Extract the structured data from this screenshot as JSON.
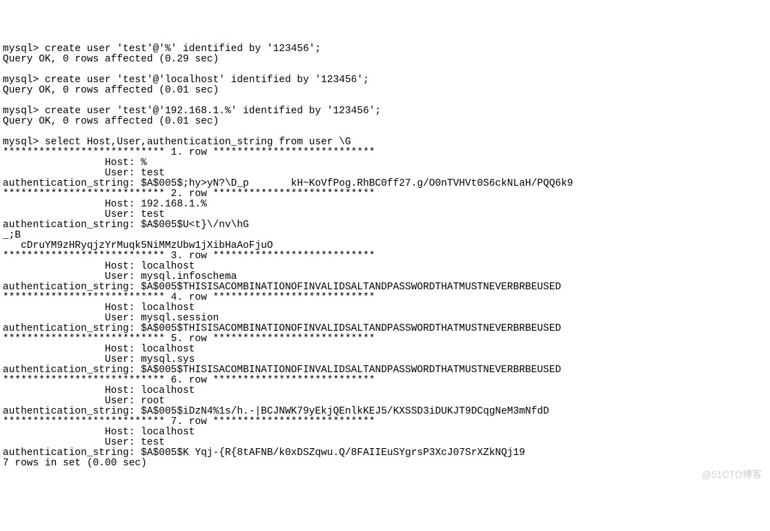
{
  "lines": [
    "mysql> create user 'test'@'%' identified by '123456';",
    "Query OK, 0 rows affected (0.29 sec)",
    "",
    "mysql> create user 'test'@'localhost' identified by '123456';",
    "Query OK, 0 rows affected (0.01 sec)",
    "",
    "mysql> create user 'test'@'192.168.1.%' identified by '123456';",
    "Query OK, 0 rows affected (0.01 sec)",
    "",
    "mysql> select Host,User,authentication_string from user \\G",
    "*************************** 1. row ***************************",
    "                 Host: %",
    "                 User: test",
    "authentication_string: $A$005$;hy>yN?\\D_p       kH~KoVfPog.RhBC0ff27.g/O0nTVHVt0S6ckNLaH/PQQ6k9",
    "*************************** 2. row ***************************",
    "                 Host: 192.168.1.%",
    "                 User: test",
    "authentication_string: $A$005$U<t}\\/nv\\hG",
    "_;B",
    "   cDruYM9zHRyqjzYrMuqk5NiMMzUbw1jXibHaAoFjuO",
    "*************************** 3. row ***************************",
    "                 Host: localhost",
    "                 User: mysql.infoschema",
    "authentication_string: $A$005$THISISACOMBINATIONOFINVALIDSALTANDPASSWORDTHATMUSTNEVERBRBEUSED",
    "*************************** 4. row ***************************",
    "                 Host: localhost",
    "                 User: mysql.session",
    "authentication_string: $A$005$THISISACOMBINATIONOFINVALIDSALTANDPASSWORDTHATMUSTNEVERBRBEUSED",
    "*************************** 5. row ***************************",
    "                 Host: localhost",
    "                 User: mysql.sys",
    "authentication_string: $A$005$THISISACOMBINATIONOFINVALIDSALTANDPASSWORDTHATMUSTNEVERBRBEUSED",
    "*************************** 6. row ***************************",
    "                 Host: localhost",
    "                 User: root",
    "authentication_string: $A$005$iDzN4%1s/h.-|BCJNWK79yEkjQEnlkKEJ5/KXSSD3iDUKJT9DCqgNeM3mNfdD",
    "*************************** 7. row ***************************",
    "                 Host: localhost",
    "                 User: test",
    "authentication_string: $A$005$K Yqj-{R{8tAFNB/k0xDSZqwu.Q/8FAIIEuSYgrsP3XcJ07SrXZkNQj19",
    "7 rows in set (0.00 sec)"
  ],
  "watermark": "@51CTO博客"
}
